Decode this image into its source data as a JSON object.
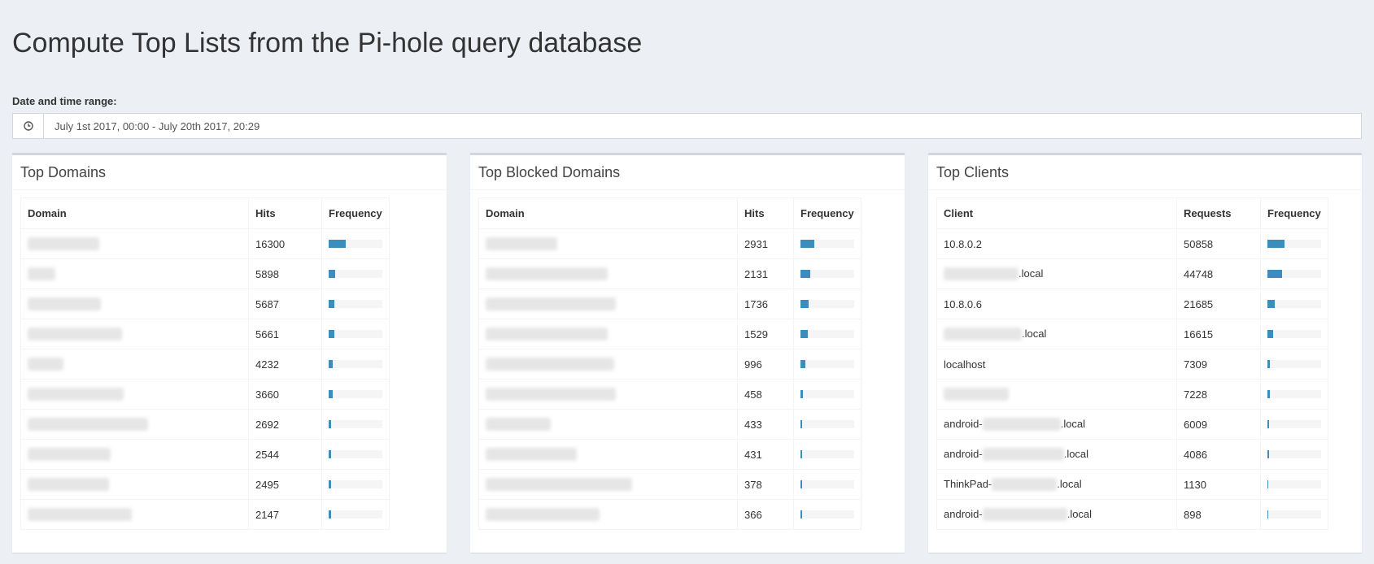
{
  "page": {
    "title": "Compute Top Lists from the Pi-hole query database",
    "range_label": "Date and time range:",
    "range_value": "July 1st 2017, 00:00 - July 20th 2017, 20:29"
  },
  "colors": {
    "bar": "#3c8dbc",
    "track": "#f5f5f5",
    "background": "#ecf0f5"
  },
  "icons": {
    "range_addon": "clock-icon"
  },
  "domains": {
    "title": "Top Domains",
    "columns": [
      "Domain",
      "Hits",
      "Frequency"
    ],
    "rows": [
      {
        "hits": "16300",
        "frequency": 32
      },
      {
        "hits": "5898",
        "frequency": 11.6
      },
      {
        "hits": "5687",
        "frequency": 11.2
      },
      {
        "hits": "5661",
        "frequency": 11.1
      },
      {
        "hits": "4232",
        "frequency": 8.3
      },
      {
        "hits": "3660",
        "frequency": 7.2
      },
      {
        "hits": "2692",
        "frequency": 5.3
      },
      {
        "hits": "2544",
        "frequency": 5
      },
      {
        "hits": "2495",
        "frequency": 4.9
      },
      {
        "hits": "2147",
        "frequency": 4.2
      }
    ]
  },
  "blocked": {
    "title": "Top Blocked Domains",
    "columns": [
      "Domain",
      "Hits",
      "Frequency"
    ],
    "rows": [
      {
        "hits": "2931",
        "frequency": 25.7
      },
      {
        "hits": "2131",
        "frequency": 18.7
      },
      {
        "hits": "1736",
        "frequency": 15.2
      },
      {
        "hits": "1529",
        "frequency": 13.4
      },
      {
        "hits": "996",
        "frequency": 8.7
      },
      {
        "hits": "458",
        "frequency": 4
      },
      {
        "hits": "433",
        "frequency": 3.8
      },
      {
        "hits": "431",
        "frequency": 3.8
      },
      {
        "hits": "378",
        "frequency": 3.3
      },
      {
        "hits": "366",
        "frequency": 3.2
      }
    ]
  },
  "clients": {
    "title": "Top Clients",
    "columns": [
      "Client",
      "Requests",
      "Frequency"
    ],
    "rows": [
      {
        "prefix": "10.8.0.2",
        "suffix": "",
        "requests": "50858",
        "frequency": 31.7
      },
      {
        "prefix": "",
        "suffix": ".local",
        "requests": "44748",
        "frequency": 27.9
      },
      {
        "prefix": "10.8.0.6",
        "suffix": "",
        "requests": "21685",
        "frequency": 13.5
      },
      {
        "prefix": "",
        "suffix": ".local",
        "requests": "16615",
        "frequency": 10.4
      },
      {
        "prefix": "localhost",
        "suffix": "",
        "requests": "7309",
        "frequency": 4.6
      },
      {
        "prefix": "",
        "suffix": "",
        "requests": "7228",
        "frequency": 4.5
      },
      {
        "prefix": "android-",
        "suffix": ".local",
        "requests": "6009",
        "frequency": 3.7
      },
      {
        "prefix": "android-",
        "suffix": ".local",
        "requests": "4086",
        "frequency": 2.5
      },
      {
        "prefix": "ThinkPad-",
        "suffix": ".local",
        "requests": "1130",
        "frequency": 0.7
      },
      {
        "prefix": "android-",
        "suffix": ".local",
        "requests": "898",
        "frequency": 0.6
      }
    ]
  }
}
